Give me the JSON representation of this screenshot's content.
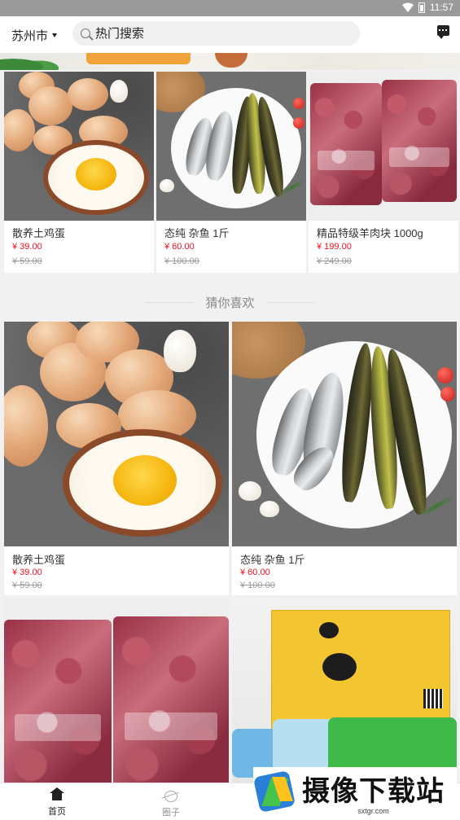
{
  "status_bar": {
    "time": "11:57"
  },
  "header": {
    "city": "苏州市",
    "search_placeholder": "热门搜索"
  },
  "top_products": [
    {
      "name": "散养土鸡蛋",
      "price": "¥ 39.00",
      "original_price": "¥ 59.00",
      "image": "eggs"
    },
    {
      "name": "态纯 杂鱼 1斤",
      "price": "¥ 60.00",
      "original_price": "¥ 100.00",
      "image": "fish"
    },
    {
      "name": "精品特级羊肉块 1000g",
      "price": "¥ 199.00",
      "original_price": "¥ 249.00",
      "image": "lamb"
    }
  ],
  "recommend": {
    "title": "猜你喜欢",
    "products": [
      {
        "name": "散养土鸡蛋",
        "price": "¥ 39.00",
        "original_price": "¥ 59.00",
        "image": "eggs"
      },
      {
        "name": "态纯 杂鱼 1斤",
        "price": "¥ 60.00",
        "original_price": "¥ 100.00",
        "image": "fish"
      },
      {
        "name": "",
        "price": "",
        "original_price": "",
        "image": "lamb"
      },
      {
        "name": "",
        "price": "",
        "original_price": "",
        "image": "gift-box"
      }
    ]
  },
  "tabbar": {
    "items": [
      {
        "label": "首页",
        "icon": "home-icon",
        "active": true
      },
      {
        "label": "圈子",
        "icon": "circle-icon",
        "active": false
      }
    ]
  },
  "watermark": {
    "title": "摄像下载站",
    "url": "sxtgr.com"
  }
}
